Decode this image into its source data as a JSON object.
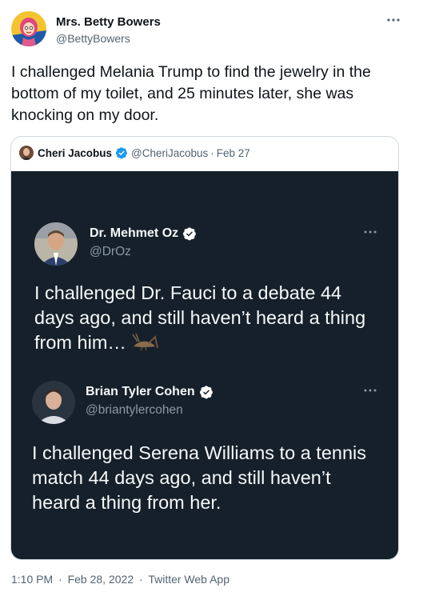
{
  "author": {
    "name": "Mrs. Betty Bowers",
    "handle": "@BettyBowers",
    "more_icon": "more-horizontal-icon"
  },
  "tweet": {
    "text": "I challenged Melania Trump to find the jewelry in the bottom of my toilet, and 25 minutes later, she was knocking on my door."
  },
  "quote": {
    "name": "Cheri Jacobus",
    "handle": "@CheriJacobus",
    "separator": "·",
    "date": "Feb 27",
    "verified_color": "#1d9bf0",
    "inner_tweets": [
      {
        "name": "Dr. Mehmet Oz",
        "handle": "@DrOz",
        "text": "I challenged Dr. Fauci to a debate 44 days ago, and still haven’t heard a thing from him…",
        "emoji": "cricket-emoji"
      },
      {
        "name": "Brian Tyler Cohen",
        "handle": "@briantylercohen",
        "text": "I challenged Serena Williams to a tennis match 44 days ago, and still haven’t heard a thing from her."
      }
    ]
  },
  "footer": {
    "time": "1:10 PM",
    "separator": "·",
    "date": "Feb 28, 2022",
    "separator2": "·",
    "source": "Twitter Web App"
  },
  "colors": {
    "dark_bg": "#15202b",
    "secondary_text": "#536471",
    "border": "#cfd9de"
  }
}
